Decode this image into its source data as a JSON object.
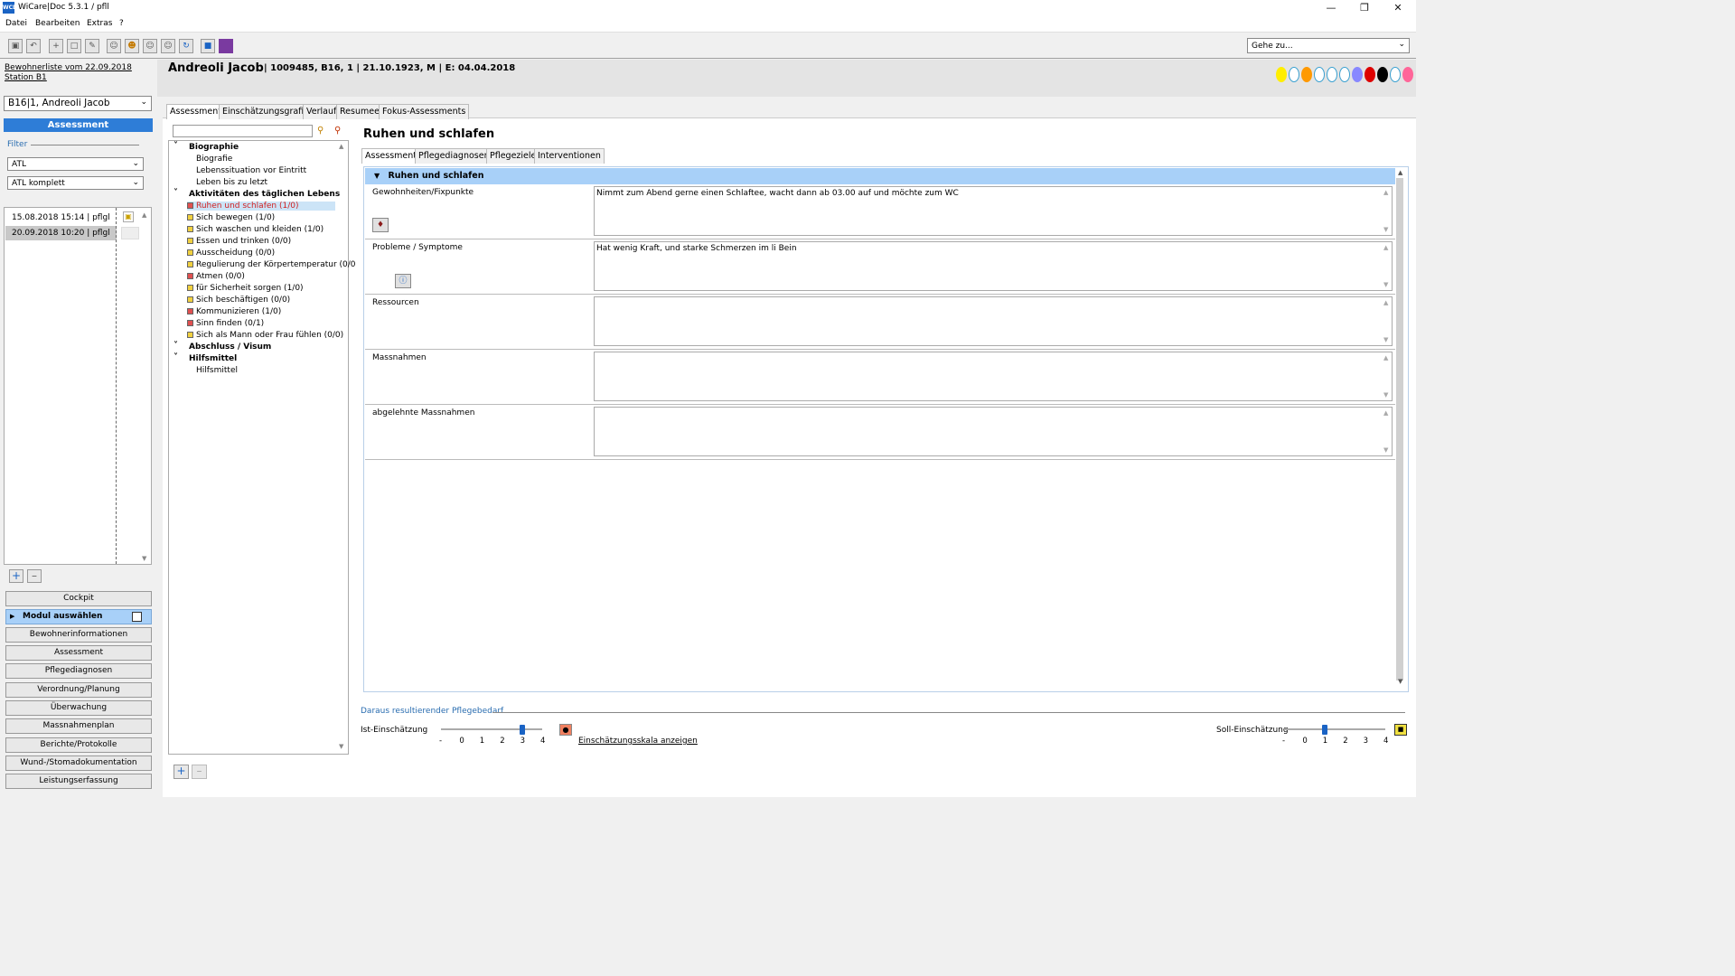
{
  "window": {
    "app_icon": "WCD",
    "title": "WiCare|Doc 5.3.1  / pfll"
  },
  "menu": [
    "Datei",
    "Bearbeiten",
    "Extras",
    "?"
  ],
  "toolbar": {
    "goto_placeholder": "Gehe zu..."
  },
  "left": {
    "residents_link": "Bewohnerliste vom 22.09.2018",
    "station_link": "Station B1",
    "resident_select": "B16|1, Andreoli Jacob",
    "assessment_button": "Assessment",
    "filter_label": "Filter",
    "filter1": "ATL",
    "filter2": "ATL komplett",
    "dates": [
      {
        "label": "15.08.2018 15:14 | pflgl"
      },
      {
        "label": "20.09.2018 10:20 | pflgl"
      }
    ],
    "nav": [
      {
        "label": "Cockpit"
      },
      {
        "label": "Modul auswählen"
      },
      {
        "label": "Bewohnerinformationen"
      },
      {
        "label": "Assessment"
      },
      {
        "label": "Pflegediagnosen"
      },
      {
        "label": "Verordnung/Planung"
      },
      {
        "label": "Überwachung"
      },
      {
        "label": "Massnahmenplan"
      },
      {
        "label": "Berichte/Protokolle"
      },
      {
        "label": "Wund-/Stomadokumentation"
      },
      {
        "label": "Leistungserfassung"
      }
    ]
  },
  "header": {
    "name": "Andreoli Jacob",
    "info": "| 1009485, B16, 1 | 21.10.1923, M | E: 04.04.2018",
    "dots": [
      "#ffee00",
      "#ffffff",
      "#ff9900",
      "#ffffff",
      "#ffffff",
      "#ffffff",
      "#8888ff",
      "#dd0000",
      "#000000",
      "#ffffff",
      "#ff6699"
    ]
  },
  "main_tabs": [
    "Assessment",
    "Einschätzungsgrafik",
    "Verlauf",
    "Resumee",
    "Fokus-Assessments"
  ],
  "tree": {
    "groups": [
      {
        "label": "Biographie",
        "items": [
          {
            "label": "Biografie"
          },
          {
            "label": "Lebenssituation vor Eintritt"
          },
          {
            "label": "Leben bis zu letzt"
          }
        ]
      },
      {
        "label": "Aktivitäten des täglichen Lebens",
        "items": [
          {
            "label": "Ruhen und schlafen (1/0)",
            "status": "red",
            "selected": true
          },
          {
            "label": "Sich bewegen (1/0)",
            "status": "yellow"
          },
          {
            "label": "Sich waschen und kleiden (1/0)",
            "status": "yellow"
          },
          {
            "label": "Essen und trinken (0/0)",
            "status": "yellow"
          },
          {
            "label": "Ausscheidung (0/0)",
            "status": "yellow"
          },
          {
            "label": "Regulierung der Körpertemperatur (0/0",
            "status": "yellow"
          },
          {
            "label": "Atmen (0/0)",
            "status": "red"
          },
          {
            "label": "für Sicherheit sorgen (1/0)",
            "status": "yellow"
          },
          {
            "label": "Sich beschäftigen (0/0)",
            "status": "yellow"
          },
          {
            "label": "Kommunizieren (1/0)",
            "status": "red"
          },
          {
            "label": "Sinn finden (0/1)",
            "status": "red"
          },
          {
            "label": "Sich als Mann oder Frau fühlen (0/0)",
            "status": "yellow"
          }
        ]
      },
      {
        "label": "Abschluss / Visum",
        "items": []
      },
      {
        "label": "Hilfsmittel",
        "items": [
          {
            "label": "Hilfsmittel"
          }
        ]
      }
    ]
  },
  "section": {
    "title": "Ruhen und schlafen",
    "tabs": [
      "Assessment",
      "Pflegediagnosen",
      "Pflegeziele",
      "Interventionen"
    ],
    "header": "Ruhen und schlafen",
    "rows": [
      {
        "label": "Gewohnheiten/Fixpunkte",
        "value": "Nimmt zum Abend gerne einen Schlaftee, wacht dann ab 03.00 auf und möchte zum WC"
      },
      {
        "label": "Probleme / Symptome",
        "value": "Hat wenig Kraft, und starke Schmerzen im li Bein"
      },
      {
        "label": "Ressourcen",
        "value": ""
      },
      {
        "label": "Massnahmen",
        "value": ""
      },
      {
        "label": "abgelehnte Massnahmen",
        "value": ""
      }
    ]
  },
  "bottom": {
    "pflegebedarf": "Daraus resultierender Pflegebedarf",
    "ist_label": "Ist-Einschätzung",
    "ist_value": 3,
    "soll_label": "Soll-Einschätzung",
    "soll_value": 1,
    "scale_ticks": [
      "-",
      "0",
      "1",
      "2",
      "3",
      "4"
    ],
    "scale_link": "Einschätzungsskala anzeigen"
  }
}
